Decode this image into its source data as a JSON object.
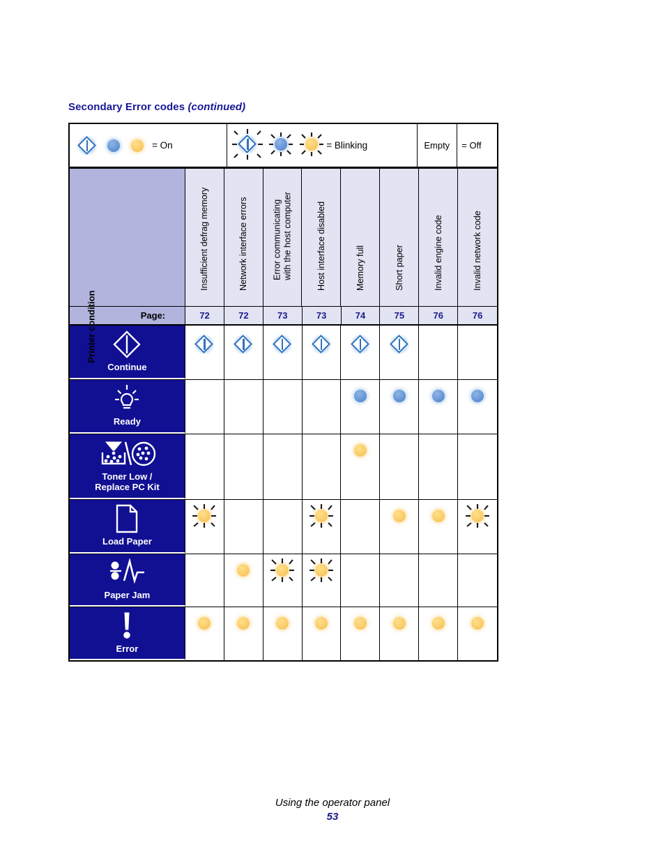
{
  "page_title": {
    "main": "Secondary Error codes",
    "continued": "(continued)"
  },
  "legend": {
    "on_label": "= On",
    "blinking_label": "= Blinking",
    "empty_label": "Empty",
    "off_label": "= Off",
    "icons_on": [
      "diamond-indicator",
      "blue-light-indicator",
      "yellow-light-indicator"
    ],
    "icons_blinking": [
      "diamond-indicator-blinking",
      "blue-light-indicator-blinking",
      "yellow-light-indicator-blinking"
    ]
  },
  "table": {
    "condition_header": "Printer condition",
    "page_label": "Page:",
    "columns": [
      {
        "label": "Insufficient defrag memory",
        "page": "72"
      },
      {
        "label": "Network interface errors",
        "page": "72"
      },
      {
        "label": "Error communicating\nwith the host computer",
        "page": "73"
      },
      {
        "label": "Host interface disabled",
        "page": "73"
      },
      {
        "label": "Memory full",
        "page": "74"
      },
      {
        "label": "Short paper",
        "page": "75"
      },
      {
        "label": "Invalid engine code",
        "page": "76"
      },
      {
        "label": "Invalid network code",
        "page": "76"
      }
    ],
    "rows": [
      {
        "label": "Continue",
        "icon": "diamond-icon",
        "states": [
          "diamond",
          "diamond",
          "diamond",
          "diamond",
          "diamond",
          "diamond",
          "",
          ""
        ]
      },
      {
        "label": "Ready",
        "icon": "light-bulb-icon",
        "states": [
          "",
          "",
          "",
          "",
          "blue",
          "blue",
          "blue",
          "blue"
        ]
      },
      {
        "label": "Toner Low /\nReplace PC Kit",
        "icon": "toner-cartridge-icon",
        "states": [
          "",
          "",
          "",
          "",
          "yellow",
          "",
          "",
          ""
        ]
      },
      {
        "label": "Load Paper",
        "icon": "paper-sheet-icon",
        "states": [
          "yellow-blink",
          "",
          "",
          "yellow-blink",
          "",
          "yellow",
          "yellow",
          "yellow-blink"
        ]
      },
      {
        "label": "Paper Jam",
        "icon": "paper-jam-icon",
        "states": [
          "",
          "yellow",
          "yellow-blink",
          "yellow-blink",
          "",
          "",
          "",
          ""
        ]
      },
      {
        "label": "Error",
        "icon": "exclamation-icon",
        "states": [
          "yellow",
          "yellow",
          "yellow",
          "yellow",
          "yellow",
          "yellow",
          "yellow",
          "yellow"
        ]
      }
    ]
  },
  "footer": {
    "title": "Using the operator panel",
    "page_number": "53"
  },
  "colors": {
    "title_blue": "#171796",
    "row_label_navy": "#110f92",
    "header_purple": "#b2b4de",
    "column_lavender": "#e2e3f3",
    "indicator_blue": "#6f9ddb",
    "indicator_yellow": "#fcd071",
    "diamond_blue": "#2e72bd"
  }
}
